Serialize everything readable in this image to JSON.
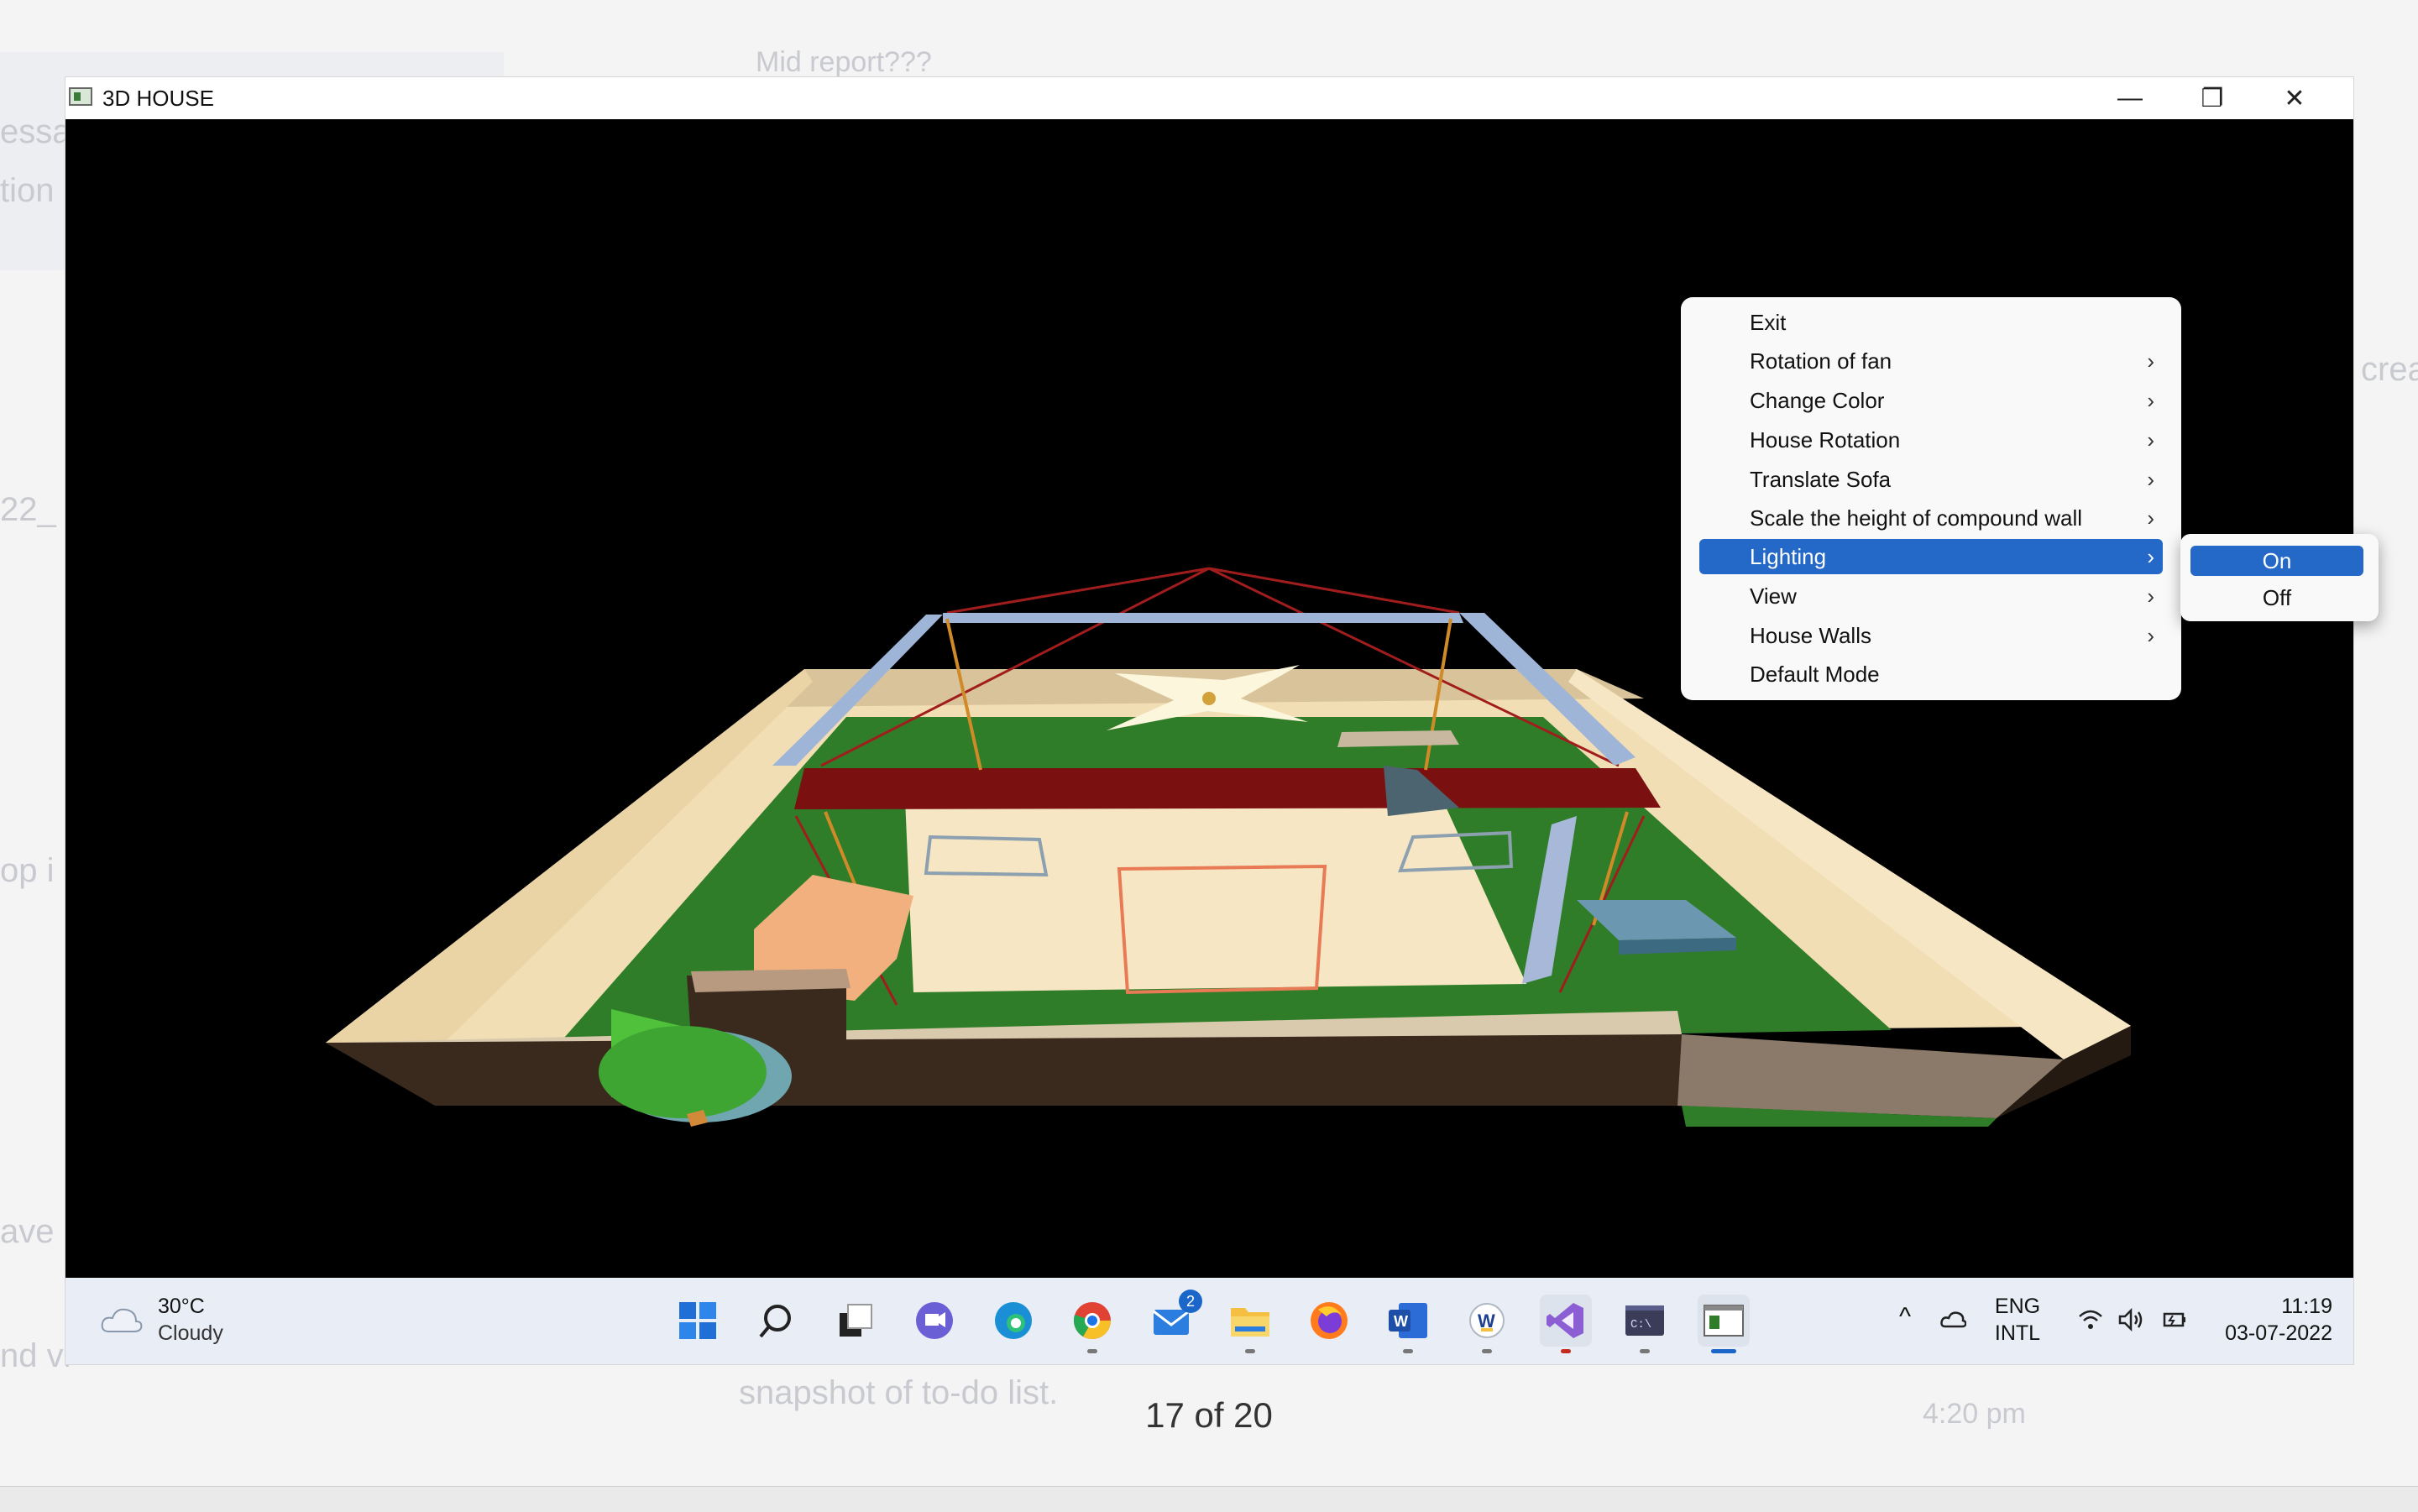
{
  "window": {
    "title": "3D HOUSE",
    "minimize_glyph": "—",
    "maximize_glyph": "❐",
    "close_glyph": "✕"
  },
  "context_menu": {
    "items": [
      {
        "label": "Exit",
        "submenu": false
      },
      {
        "label": "Rotation of fan",
        "submenu": true
      },
      {
        "label": "Change Color",
        "submenu": true
      },
      {
        "label": "House Rotation",
        "submenu": true
      },
      {
        "label": "Translate Sofa",
        "submenu": true
      },
      {
        "label": "Scale the height of compound wall",
        "submenu": true
      },
      {
        "label": "Lighting",
        "submenu": true,
        "highlighted": true
      },
      {
        "label": "View",
        "submenu": true
      },
      {
        "label": "House Walls",
        "submenu": true
      },
      {
        "label": "Default Mode",
        "submenu": false
      }
    ],
    "submenu_arrow": "›",
    "lighting_submenu": [
      {
        "label": "On",
        "highlighted": true
      },
      {
        "label": "Off"
      }
    ],
    "highlight_color": "#2468c8"
  },
  "taskbar": {
    "weather": {
      "temperature": "30°C",
      "condition": "Cloudy"
    },
    "apps": [
      "start-icon",
      "search-icon",
      "task-view-icon",
      "teams-chat-icon",
      "edge-icon",
      "chrome-icon",
      "mail-icon",
      "file-explorer-icon",
      "firefox-icon",
      "word-icon",
      "vscode-icon",
      "visual-studio-icon",
      "terminal-icon",
      "3d-house-app-icon"
    ],
    "mail_badge": "2",
    "language": {
      "line1": "ENG",
      "line2": "INTL"
    },
    "clock": {
      "time": "11:19",
      "date": "03-07-2022"
    },
    "chevron_glyph": "^"
  },
  "viewer": {
    "page_counter": "17 of 20"
  },
  "background_fragments": [
    "essa",
    "tion",
    "22_",
    "op i",
    "ave c",
    "nd vi",
    "Mid report???",
    "snapshot of to-do list.",
    "4:20 pm",
    "crea"
  ],
  "colors": {
    "ground": "#2f7d28",
    "wall_beige": "#f2deb4",
    "wall_dark": "#3a2a1e",
    "roof_red": "#7a1010",
    "floor": "#f7e6c3",
    "tree": "#4fc13b"
  }
}
